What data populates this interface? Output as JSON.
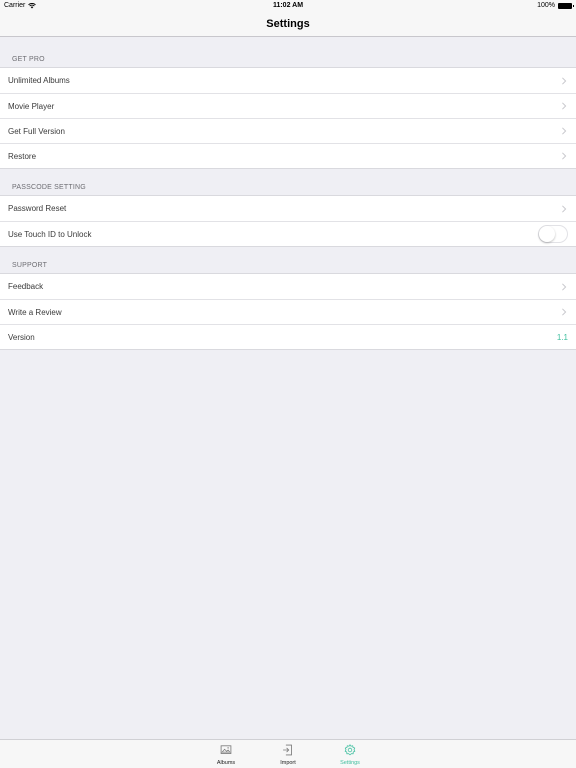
{
  "status_bar": {
    "carrier": "Carrier",
    "time": "11:02 AM",
    "battery": "100%"
  },
  "nav": {
    "title": "Settings"
  },
  "sections": [
    {
      "header": "GET PRO",
      "rows": [
        {
          "label": "Unlimited Albums"
        },
        {
          "label": "Movie Player"
        },
        {
          "label": "Get Full Version"
        },
        {
          "label": "Restore"
        }
      ]
    },
    {
      "header": "PASSCODE SETTING",
      "rows": [
        {
          "label": "Password Reset"
        },
        {
          "label": "Use Touch ID to Unlock",
          "toggle": false
        }
      ]
    },
    {
      "header": "SUPPORT",
      "rows": [
        {
          "label": "Feedback"
        },
        {
          "label": "Write a Review"
        },
        {
          "label": "Version",
          "value": "1.1"
        }
      ]
    }
  ],
  "tab_bar": {
    "tabs": [
      {
        "label": "Albums",
        "icon": "albums-icon",
        "active": false
      },
      {
        "label": "Import",
        "icon": "import-icon",
        "active": false
      },
      {
        "label": "Settings",
        "icon": "gear-icon",
        "active": true
      }
    ]
  },
  "colors": {
    "accent": "#3fbf9f",
    "background": "#efeff4"
  }
}
